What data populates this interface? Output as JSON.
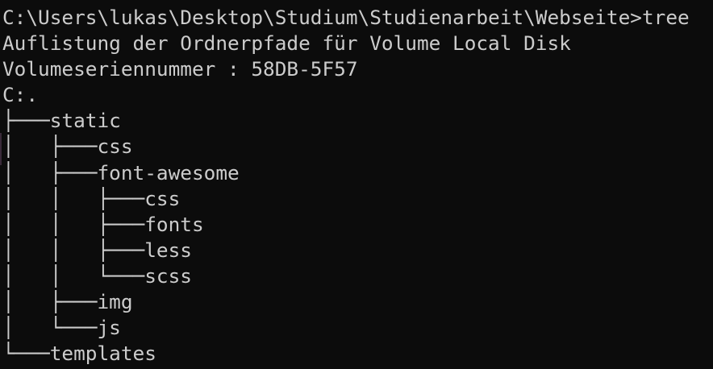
{
  "console": {
    "command_line": "C:\\Users\\lukas\\Desktop\\Studium\\Studienarbeit\\Webseite>tree",
    "header_line": "Auflistung der Ordnerpfade für Volume Local Disk",
    "serial_line": "Volumeseriennummer : 58DB-5F57",
    "root_line": "C:.",
    "tree_lines": [
      "├───static",
      "│   ├───css",
      "│   ├───font-awesome",
      "│   │   ├───css",
      "│   │   ├───fonts",
      "│   │   ├───less",
      "│   │   └───scss",
      "│   ├───img",
      "│   └───js",
      "└───templates"
    ]
  }
}
